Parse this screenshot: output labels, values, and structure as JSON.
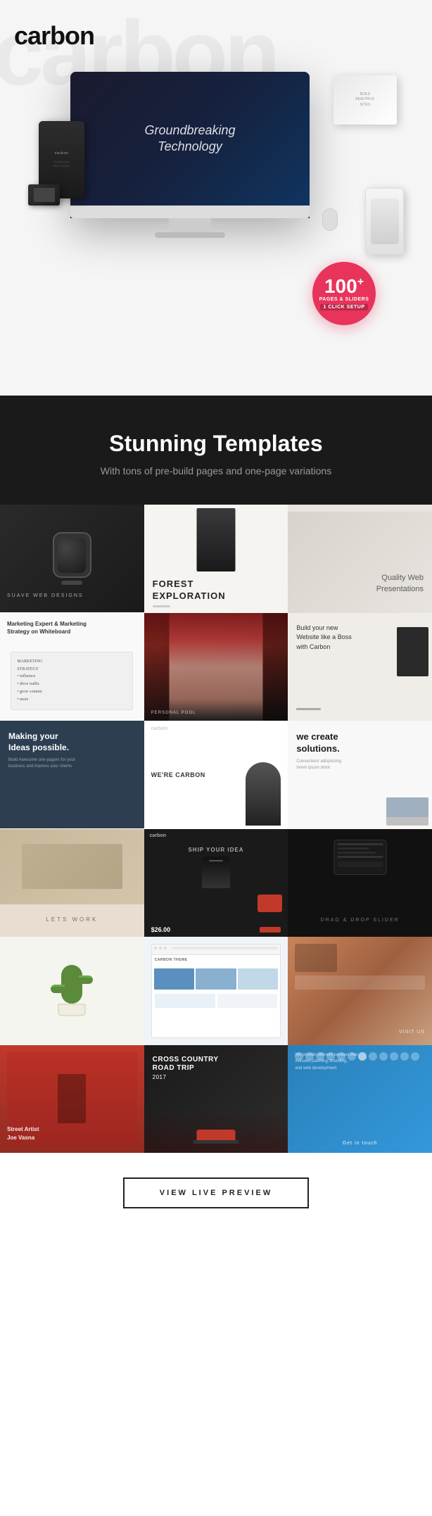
{
  "brand": {
    "name": "carbon",
    "logo_bg_text": "carbon"
  },
  "hero": {
    "monitor_text_line1": "Groundbreaking",
    "monitor_text_line2": "Technology",
    "badge": {
      "number": "100",
      "superscript": "+",
      "line1": "PAGES & SLIDERS",
      "line2": "1 CLICK SETUP"
    }
  },
  "stunning_section": {
    "title": "Stunning Templates",
    "subtitle": "With tons of pre-build pages and one-page variations"
  },
  "grid_items": [
    {
      "id": "dark-watch",
      "label": "SUAVE WEB DESIGN"
    },
    {
      "id": "forest",
      "title": "FOREST",
      "subtitle": "EXPLORATION"
    },
    {
      "id": "quality",
      "text": "Quality Web\nPresentations"
    },
    {
      "id": "whiteboard",
      "text": "Marketing Expert & Marketing\nStrategy on Whiteboard"
    },
    {
      "id": "redhead",
      "text": ""
    },
    {
      "id": "boss",
      "text": "Build your new\nWebsite like a Boss\nwith Carbon"
    },
    {
      "id": "making",
      "title": "Making your\nIdeas possible.",
      "sub": "Build Awesome one-pagers for your\nbusiness and impress your clients"
    },
    {
      "id": "wecarbon",
      "text": "WE'RE CARBON"
    },
    {
      "id": "solutions",
      "title": "we create\nsolutions."
    },
    {
      "id": "letswork",
      "text": "LETS WORK"
    },
    {
      "id": "shipidea",
      "title": "Ship Your Idea",
      "price": "$26.00"
    },
    {
      "id": "dragdrop",
      "text": "DRAG & DROP SLIDER"
    },
    {
      "id": "cactus",
      "text": ""
    },
    {
      "id": "carbontheme",
      "text": "CARBON THEME"
    },
    {
      "id": "foodstyle",
      "text": "VISIT US"
    },
    {
      "id": "streetartist",
      "line1": "Street Artist",
      "line2": "Joe Vasna"
    },
    {
      "id": "roadtrip",
      "line1": "CROSS COUNTRY",
      "line2": "ROAD TRIP",
      "year": "2017"
    },
    {
      "id": "getintouch",
      "text": "Get in touch"
    }
  ],
  "preview_button": {
    "label": "VIEW LIVE PREVIEW"
  }
}
